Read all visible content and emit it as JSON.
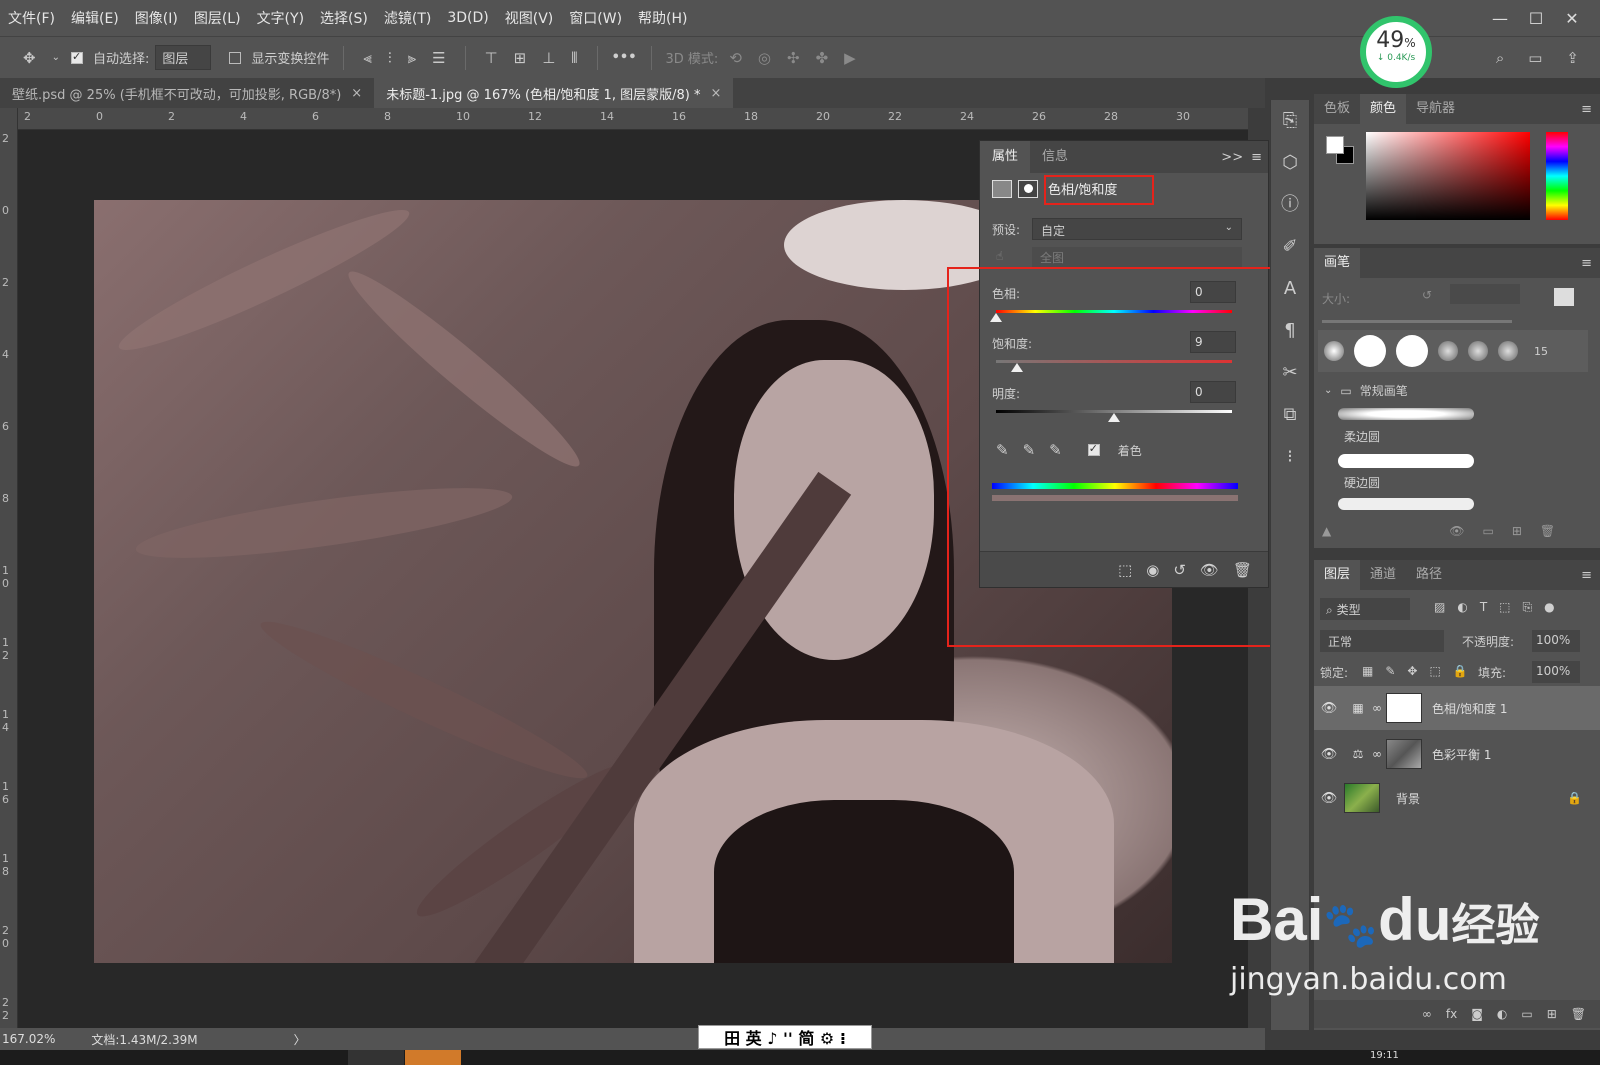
{
  "menubar": {
    "items": [
      "文件(F)",
      "编辑(E)",
      "图像(I)",
      "图层(L)",
      "文字(Y)",
      "选择(S)",
      "滤镜(T)",
      "3D(D)",
      "视图(V)",
      "窗口(W)",
      "帮助(H)"
    ],
    "window_buttons": [
      "—",
      "☐",
      "✕"
    ]
  },
  "options": {
    "auto_select_label": "自动选择:",
    "auto_select_value": "图层",
    "show_transform_label": "显示变换控件",
    "more": "•••",
    "mode_3d_label": "3D 模式:"
  },
  "tabs": [
    {
      "label": "壁纸.psd @ 25% (手机框不可改动，可加投影, RGB/8*)",
      "close": "×"
    },
    {
      "label": "未标题-1.jpg @ 167% (色相/饱和度 1, 图层蒙版/8) *",
      "close": "×"
    }
  ],
  "ruler": {
    "top": [
      "2",
      "0",
      "2",
      "4",
      "6",
      "8",
      "10",
      "12",
      "14",
      "16",
      "18",
      "20",
      "22",
      "24",
      "26",
      "28",
      "30"
    ],
    "left": [
      "2",
      "0",
      "2",
      "4",
      "6",
      "8",
      "1 0",
      "1 2",
      "1 4",
      "1 6",
      "1 8",
      "2 0",
      "2 2"
    ]
  },
  "status": {
    "zoom": "167.02%",
    "doc": "文档:1.43M/2.39M",
    "arrow": "〉"
  },
  "ime": {
    "text": "田 英 ♪ '' 简 ⚙ ⁝"
  },
  "speed_widget": {
    "percent": "49",
    "unit": "%",
    "rate": "↓ 0.4K/s"
  },
  "properties_panel": {
    "tabs": [
      "属性",
      "信息"
    ],
    "expand": ">>",
    "title": "色相/饱和度",
    "preset_label": "预设:",
    "preset_value": "自定",
    "range_value": "全图",
    "hue_label": "色相:",
    "hue_value": "0",
    "sat_label": "饱和度:",
    "sat_value": "9",
    "light_label": "明度:",
    "light_value": "0",
    "colorize_label": "着色",
    "colorize_checked": true,
    "hue_level": 0.0,
    "sat_level": 0.09,
    "light_level": 0.5
  },
  "right_panels": {
    "color_tabs": [
      "色板",
      "颜色",
      "导航器"
    ],
    "brush_tab": "画笔",
    "brush_size_label": "大小:",
    "brush_count": "15",
    "brush_group": "常规画笔",
    "brush_items": [
      "柔边圆",
      "硬边圆"
    ],
    "layer_tabs": [
      "图层",
      "通道",
      "路径"
    ],
    "kind_label": "类型",
    "blend_mode": "正常",
    "opacity_label": "不透明度:",
    "opacity_value": "100%",
    "lock_label": "锁定:",
    "fill_label": "填充:",
    "fill_value": "100%",
    "layers": [
      {
        "name": "色相/饱和度 1"
      },
      {
        "name": "色彩平衡 1"
      },
      {
        "name": "背景"
      }
    ]
  },
  "watermark": {
    "brand": "Bai",
    "paw": "🐾",
    "du": "du",
    "jy": "经验",
    "url": "jingyan.baidu.com"
  },
  "taskbar": {
    "clock": "19:11"
  }
}
